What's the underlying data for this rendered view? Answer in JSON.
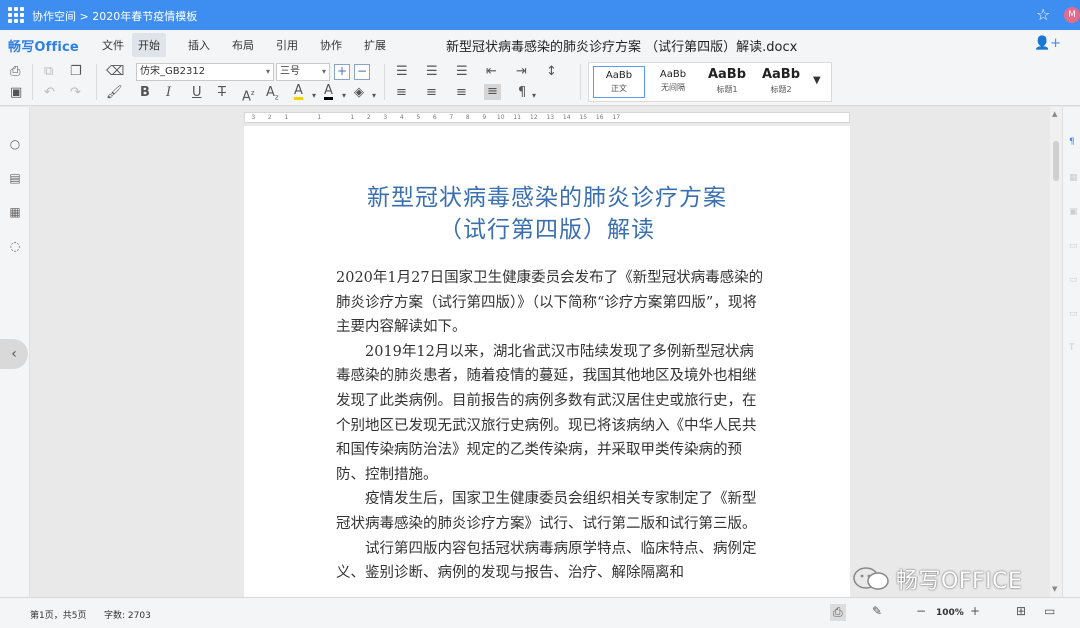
{
  "topbar": {
    "breadcrumb": "协作空间 > 2020年春节疫情模板",
    "avatar_initial": "M"
  },
  "app": {
    "brand": "畅写Office",
    "doc_title": "新型冠状病毒感染的肺炎诊疗方案 （试行第四版）解读.docx"
  },
  "menu": [
    "文件",
    "开始",
    "插入",
    "布局",
    "引用",
    "协作",
    "扩展"
  ],
  "menu_active": "开始",
  "toolbar": {
    "font_name": "仿宋_GB2312",
    "font_size": "三号",
    "styles": [
      {
        "sample": "AaBb",
        "name": "正文",
        "selected": true
      },
      {
        "sample": "AaBb",
        "name": "无间隔",
        "selected": false
      },
      {
        "sample": "AaBb",
        "name": "标题1",
        "selected": false
      },
      {
        "sample": "AaBb",
        "name": "标题2",
        "selected": false
      }
    ]
  },
  "ruler": [
    "3",
    "2",
    "1",
    "",
    "1",
    "",
    "1",
    "2",
    "3",
    "4",
    "5",
    "6",
    "7",
    "8",
    "9",
    "10",
    "11",
    "12",
    "13",
    "14",
    "15",
    "16",
    "17",
    "",
    "",
    "",
    "",
    "",
    "",
    "",
    "",
    "",
    "",
    "",
    "",
    "",
    "",
    "",
    "",
    "",
    "",
    "",
    "",
    "",
    "",
    "",
    "",
    "",
    "",
    "",
    "",
    "",
    "",
    "",
    "",
    "",
    "",
    "",
    "",
    "",
    "",
    "",
    "",
    "",
    "",
    "",
    ""
  ],
  "document": {
    "heading_line1": "新型冠状病毒感染的肺炎诊疗方案",
    "heading_line2": "（试行第四版）解读",
    "paragraphs": [
      {
        "text": "2020年1月27日国家卫生健康委员会发布了《新型冠状病毒感染的肺炎诊疗方案（试行第四版）》（以下简称“诊疗方案第四版”，现将主要内容解读如下。",
        "indent": false
      },
      {
        "text": "2019年12月以来，湖北省武汉市陆续发现了多例新型冠状病毒感染的肺炎患者，随着疫情的蔓延，我国其他地区及境外也相继发现了此类病例。目前报告的病例多数有武汉居住史或旅行史，在个别地区已发现无武汉旅行史病例。现已将该病纳入《中华人民共和国传染病防治法》规定的乙类传染病，并采取甲类传染病的预防、控制措施。",
        "indent": true
      },
      {
        "text": "疫情发生后，国家卫生健康委员会组织相关专家制定了《新型冠状病毒感染的肺炎诊疗方案》试行、试行第二版和试行第三版。",
        "indent": true
      },
      {
        "text": "试行第四版内容包括冠状病毒病原学特点、临床特点、病例定义、鉴别诊断、病例的发现与报告、治疗、解除隔离和",
        "indent": true
      }
    ]
  },
  "watermark": "畅写OFFICE",
  "status": {
    "page_info": "第1页，共5页",
    "word_count": "字数: 2703",
    "zoom": "100%"
  }
}
